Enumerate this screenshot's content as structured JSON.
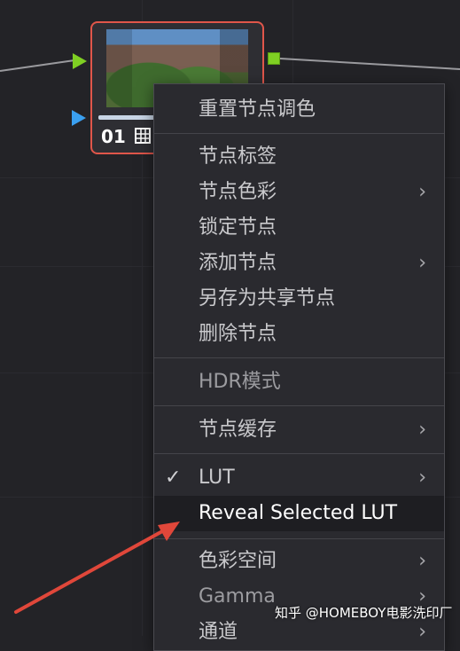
{
  "node": {
    "number": "01",
    "thumbnail_icon": "house-photo-thumbnail",
    "grid_icon": "grid-icon"
  },
  "menu": {
    "items": [
      {
        "label": "重置节点调色",
        "has_submenu": false
      },
      {
        "label": "节点标签",
        "has_submenu": false
      },
      {
        "label": "节点色彩",
        "has_submenu": true
      },
      {
        "label": "锁定节点",
        "has_submenu": false
      },
      {
        "label": "添加节点",
        "has_submenu": true
      },
      {
        "label": "另存为共享节点",
        "has_submenu": false
      },
      {
        "label": "删除节点",
        "has_submenu": false
      },
      {
        "label": "HDR模式",
        "has_submenu": false
      },
      {
        "label": "节点缓存",
        "has_submenu": true
      },
      {
        "label": "LUT",
        "has_submenu": true,
        "checked": true
      },
      {
        "label": "Reveal Selected LUT",
        "has_submenu": false,
        "highlighted": true
      },
      {
        "label": "色彩空间",
        "has_submenu": true
      },
      {
        "label": "Gamma",
        "has_submenu": true
      },
      {
        "label": "通道",
        "has_submenu": true
      }
    ],
    "chevron": "›",
    "checkmark": "✓"
  },
  "watermark": "知乎 @HOMEBOY电影洗印厂",
  "colors": {
    "background": "#232327",
    "node_border": "#e0564a",
    "menu_bg": "#2a2a2f",
    "highlight_bg": "#1e1e22",
    "arrow": "#e0473a",
    "port_green": "#7fcf23",
    "port_blue": "#3aa0f0"
  }
}
